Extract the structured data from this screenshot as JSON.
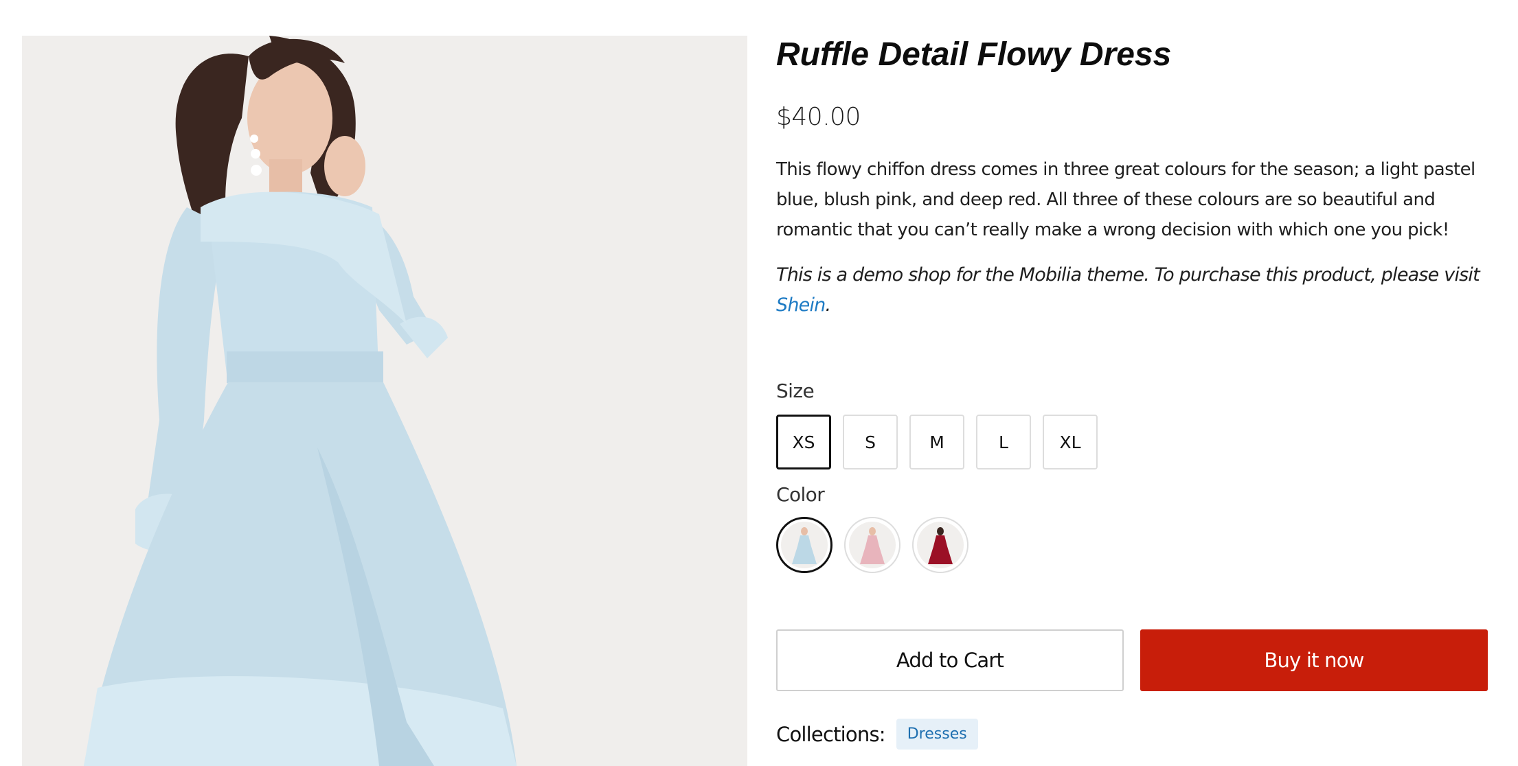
{
  "product": {
    "title": "Ruffle Detail Flowy Dress",
    "price": "$40.00",
    "description": "This flowy chiffon dress comes in three great colours for the season; a light pastel blue, blush pink, and deep red. All three of these colours are so beautiful and romantic that you can’t really make a wrong decision with which one you pick!",
    "note_prefix": "This is a demo shop for the Mobilia theme. To purchase this product, please visit ",
    "note_link": "Shein",
    "note_suffix": ".",
    "image_icon": "dress-photo"
  },
  "size": {
    "label": "Size",
    "options": [
      "XS",
      "S",
      "M",
      "L",
      "XL"
    ],
    "selected": "XS"
  },
  "color": {
    "label": "Color",
    "options": [
      {
        "name": "light-blue",
        "hex": "#bcd8e6",
        "selected": true
      },
      {
        "name": "blush-pink",
        "hex": "#e8b4bc",
        "selected": false
      },
      {
        "name": "deep-red",
        "hex": "#9b1026",
        "selected": false
      }
    ]
  },
  "actions": {
    "add_to_cart": "Add to Cart",
    "buy_now": "Buy it now"
  },
  "collections": {
    "label": "Collections:",
    "items": [
      "Dresses"
    ]
  },
  "colors": {
    "buy_button": "#c81e0a",
    "link": "#1e7bc4",
    "tag_bg": "#e6f0f8",
    "dress": "#c6dde9",
    "image_bg": "#f0eeec"
  }
}
